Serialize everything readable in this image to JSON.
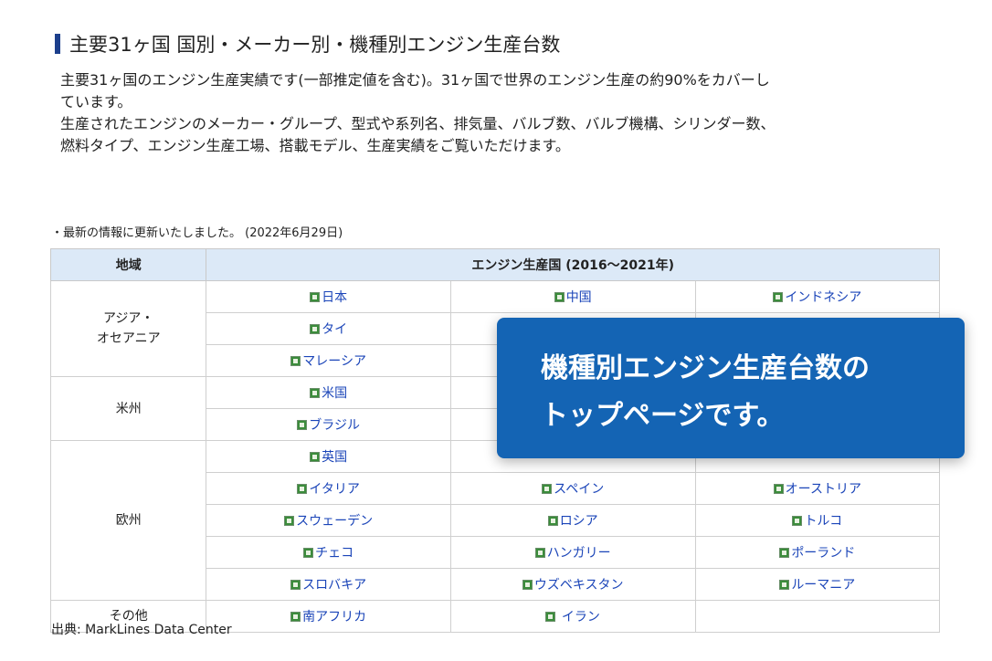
{
  "header": {
    "title": "主要31ヶ国 国別・メーカー別・機種別エンジン生産台数"
  },
  "description": {
    "line1": "主要31ヶ国のエンジン生産実績です(一部推定値を含む)。31ヶ国で世界のエンジン生産の約90%をカバーし",
    "line2": "ています。",
    "line3": "生産されたエンジンのメーカー・グループ、型式や系列名、排気量、バルブ数、バルブ機構、シリンダー数、",
    "line4": "燃料タイプ、エンジン生産工場、搭載モデル、生産実績をご覧いただけます。"
  },
  "update_note": "・最新の情報に更新いたしました。 (2022年6月29日)",
  "table": {
    "header_region": "地域",
    "header_countries": "エンジン生産国 (2016～2021年)",
    "icon": "excel-file-icon",
    "regions": [
      {
        "name_line1": "アジア・",
        "name_line2": "オセアニア",
        "rows": [
          [
            "日本",
            "中国",
            "インドネシア"
          ],
          [
            "タイ",
            "",
            ""
          ],
          [
            "マレーシア",
            "",
            ""
          ]
        ]
      },
      {
        "name_line1": "米州",
        "rows": [
          [
            "米国",
            "",
            ""
          ],
          [
            "ブラジル",
            "",
            ""
          ]
        ]
      },
      {
        "name_line1": "欧州",
        "rows": [
          [
            "英国",
            "",
            ""
          ],
          [
            "イタリア",
            "スペイン",
            "オーストリア"
          ],
          [
            "スウェーデン",
            "ロシア",
            "トルコ"
          ],
          [
            "チェコ",
            "ハンガリー",
            "ポーランド"
          ],
          [
            "スロバキア",
            "ウズベキスタン",
            "ルーマニア"
          ]
        ]
      },
      {
        "name_line1": "その他",
        "rows": [
          [
            "南アフリカ",
            " イラン",
            ""
          ]
        ]
      }
    ]
  },
  "source": "出典: MarkLines Data Center",
  "popup": {
    "line1": "機種別エンジン生産台数の",
    "line2": "トップページです。"
  },
  "colors": {
    "popup_bg": "#1464b4",
    "header_bg": "#dce9f7",
    "link": "#1a44b8",
    "title_bar": "#1c3f8c"
  }
}
